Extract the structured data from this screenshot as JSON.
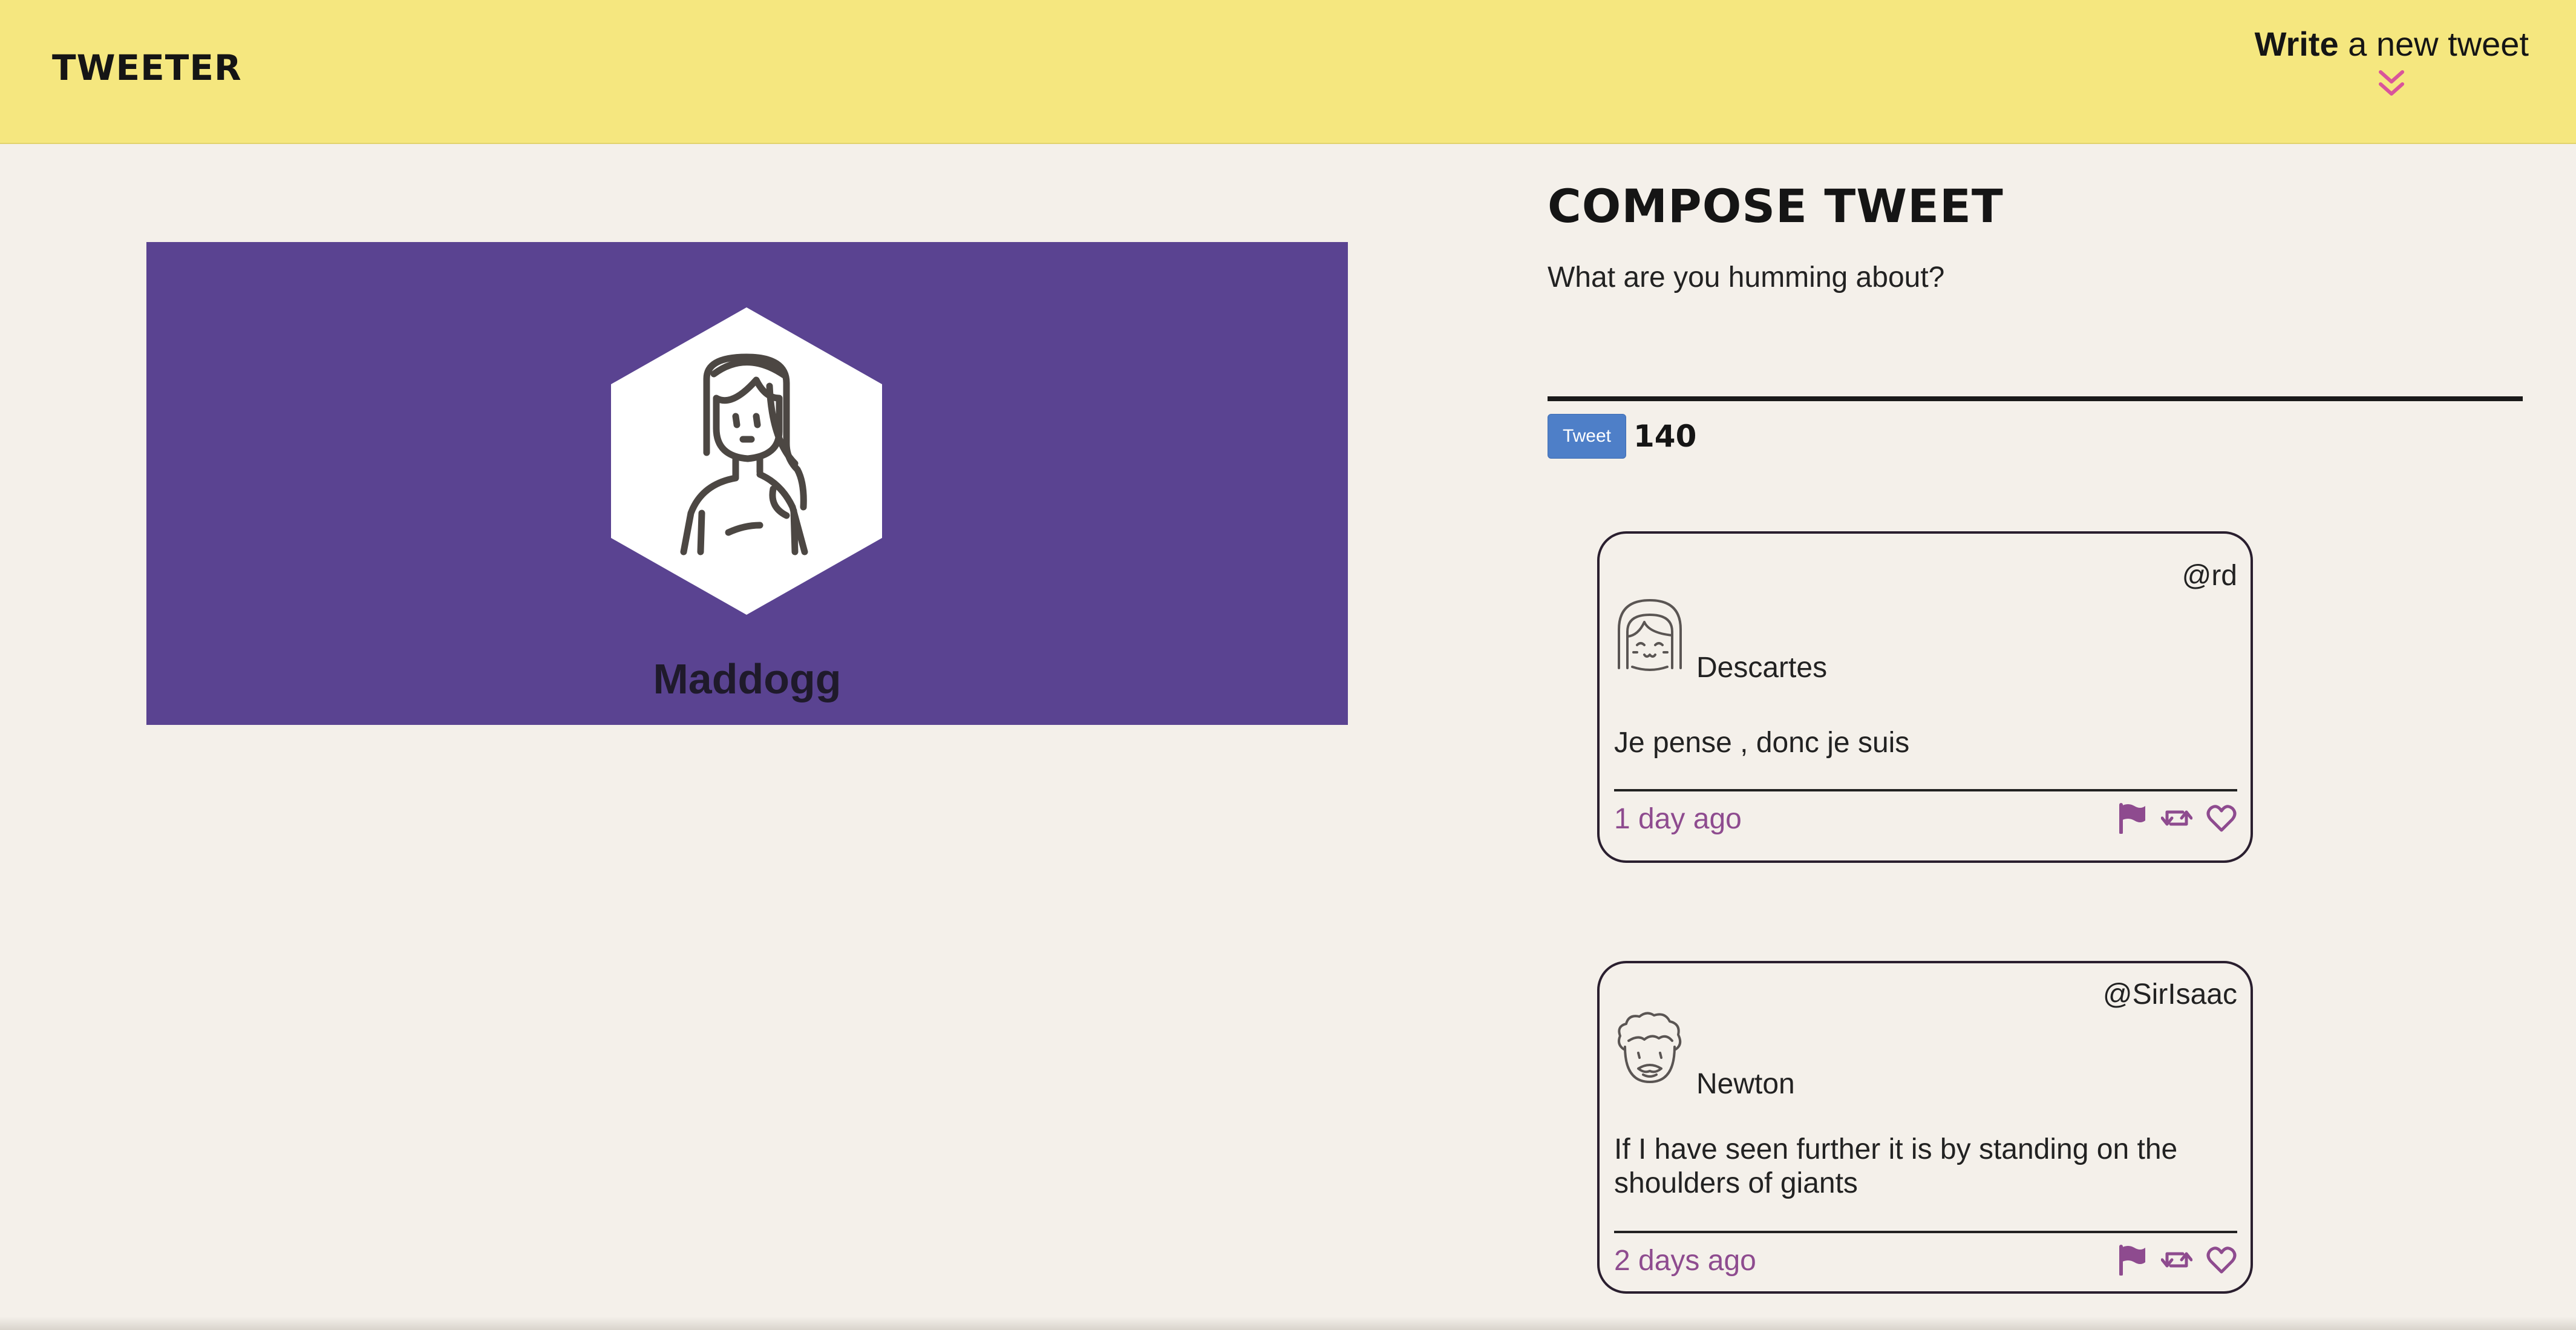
{
  "nav": {
    "brand": "TWEETER",
    "write_bold": "Write",
    "write_rest": " a new tweet",
    "toggle_icon": "double-chevron-down-icon"
  },
  "profile": {
    "name": "Maddogg",
    "avatar_icon": "woman-avatar-icon",
    "panel_color": "#5a4391"
  },
  "compose": {
    "title": "COMPOSE TWEET",
    "placeholder": "What are you humming about?",
    "button": "Tweet",
    "counter": "140"
  },
  "tweets": [
    {
      "handle": "@rd",
      "name": "Descartes",
      "avatar_icon": "girl-avatar-icon",
      "text": "Je pense , donc je suis",
      "time": "1 day ago",
      "actions": [
        "flag-icon",
        "retweet-icon",
        "heart-icon"
      ]
    },
    {
      "handle": "@SirIsaac",
      "name": "Newton",
      "avatar_icon": "curly-man-avatar-icon",
      "text": "If I have seen further it is by standing on the shoulders of giants",
      "time": "2 days ago",
      "actions": [
        "flag-icon",
        "retweet-icon",
        "heart-icon"
      ]
    }
  ],
  "colors": {
    "nav_bg": "#f5e77f",
    "page_bg": "#f4f0ea",
    "accent_purple": "#8e4b8f",
    "button_blue": "#4e7fc8",
    "chevron_pink": "#d9549b"
  }
}
